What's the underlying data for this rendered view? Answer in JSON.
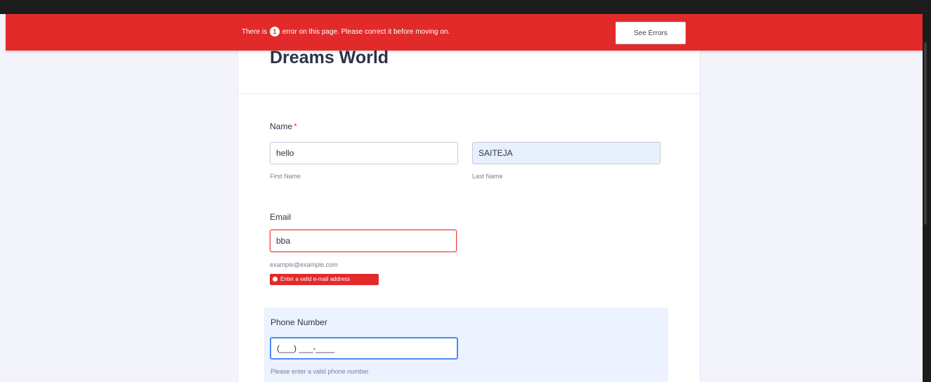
{
  "banner": {
    "text_before": "There is",
    "count": "1",
    "text_after": "error on this page. Please correct it before moving on.",
    "button_label": "See Errors"
  },
  "form": {
    "title": "Dreams World",
    "name_field": {
      "label": "Name",
      "required_mark": "*",
      "first_value": "hello",
      "first_sublabel": "First Name",
      "last_value": "SAITEJA",
      "last_sublabel": "Last Name"
    },
    "email_field": {
      "label": "Email",
      "value": "bba",
      "sublabel": "example@example.com",
      "error": "Enter a valid e-mail address"
    },
    "phone_field": {
      "label": "Phone Number",
      "value": "(___) ___-____",
      "sublabel": "Please enter a valid phone number."
    }
  },
  "colors": {
    "banner": "#e22a2a",
    "page_background": "#f3f4fb",
    "focus_border": "#4c8bf5",
    "autofill": "#e8f0fe"
  }
}
